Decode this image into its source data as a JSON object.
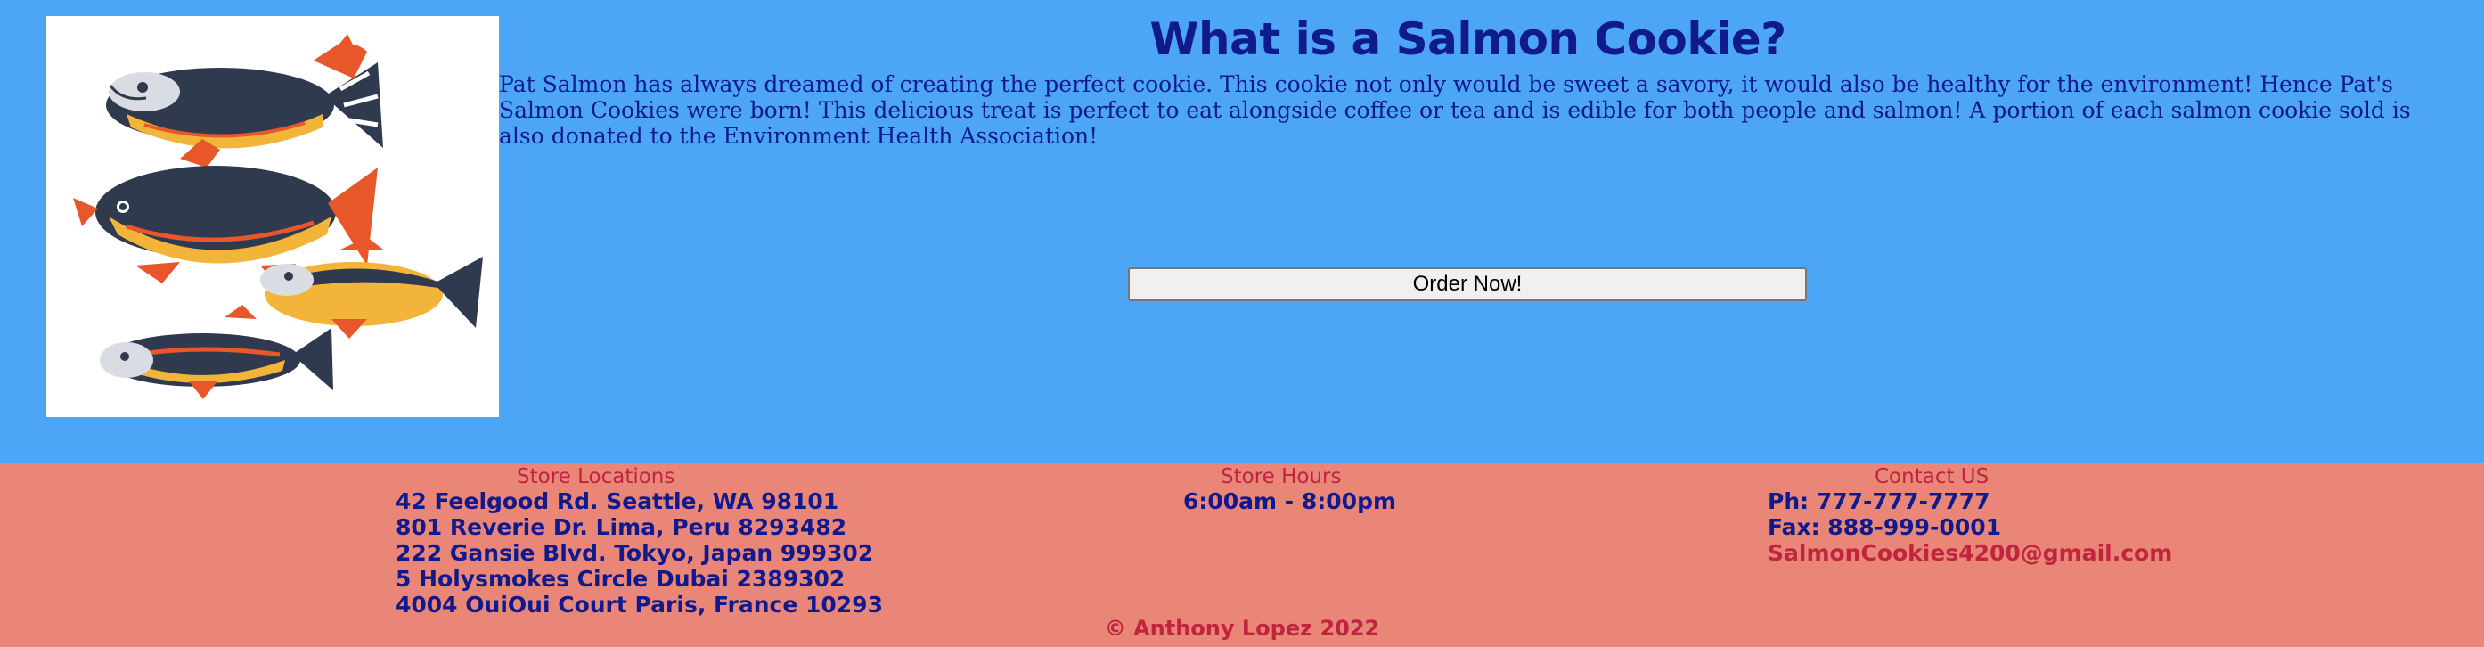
{
  "hero": {
    "title": "What is a Salmon Cookie?",
    "intro": "Pat Salmon has always dreamed of creating the perfect cookie. This cookie not only would be sweet a savory, it would also be healthy for the environment! Hence Pat's Salmon Cookies were born! This delicious treat is perfect to eat alongside coffee or tea and is edible for both people and salmon! A portion of each salmon cookie sold is also donated to the Environment Health Association!",
    "order_label": "Order Now!",
    "image_icon": "salmon-fish-illustration"
  },
  "footer": {
    "locations": {
      "heading": "Store Locations",
      "lines": [
        "42 Feelgood Rd. Seattle, WA 98101",
        "801 Reverie Dr. Lima, Peru 8293482",
        "222 Gansie Blvd. Tokyo, Japan 999302",
        "5 Holysmokes Circle Dubai 2389302",
        "4004 OuiOui Court Paris, France 10293"
      ]
    },
    "hours": {
      "heading": "Store Hours",
      "lines": [
        "6:00am - 8:00pm"
      ]
    },
    "contact": {
      "heading": "Contact US",
      "phone": "Ph: 777-777-7777",
      "fax": "Fax: 888-999-0001",
      "email": "SalmonCookies4200@gmail.com"
    },
    "copyright": "© Anthony Lopez 2022"
  },
  "colors": {
    "background": "#4da6f5",
    "footer": "#e98677",
    "text": "#101a8c",
    "accent": "#c0243f"
  }
}
